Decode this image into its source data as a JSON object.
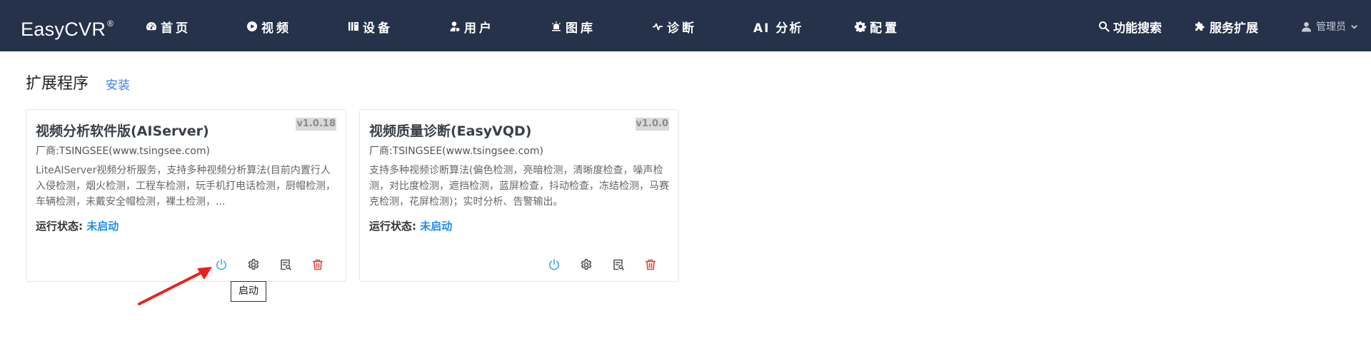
{
  "header": {
    "brand": "EasyCVR",
    "brand_mark": "®",
    "nav": [
      {
        "label": "首页",
        "icon": "dashboard-icon"
      },
      {
        "label": "视频",
        "icon": "play-circle-icon"
      },
      {
        "label": "设备",
        "icon": "device-icon"
      },
      {
        "label": "用户",
        "icon": "user-icon"
      },
      {
        "label": "图库",
        "icon": "gallery-icon"
      },
      {
        "label": "诊断",
        "icon": "pulse-icon"
      },
      {
        "label": "AI 分析",
        "icon": ""
      },
      {
        "label": "配置",
        "icon": "gear-icon"
      }
    ],
    "search_label": "功能搜索",
    "extension_label": "服务扩展",
    "admin_label": "管理员"
  },
  "page": {
    "title": "扩展程序",
    "install_label": "安装"
  },
  "cards": [
    {
      "name": "视频分析软件版(AIServer)",
      "version": "v1.0.18",
      "vendor": "厂商:TSINGSEE(www.tsingsee.com)",
      "description": "LiteAIServer视频分析服务，支持多种视频分析算法(目前内置行人入侵检测，烟火检测，工程车检测，玩手机打电话检测，厨帽检测，车辆检测，未戴安全帽检测，裸土检测，...",
      "status_label": "运行状态: ",
      "status_value": "未启动"
    },
    {
      "name": "视频质量诊断(EasyVQD)",
      "version": "v1.0.0",
      "vendor": "厂商:TSINGSEE(www.tsingsee.com)",
      "description": "支持多种视频诊断算法(偏色检测，亮暗检测，清晰度检查，噪声检测，对比度检测，遮挡检测，蓝屏检查，抖动检查，冻结检测，马赛克检测，花屏检测)；实时分析、告警输出。",
      "status_label": "运行状态: ",
      "status_value": "未启动"
    }
  ],
  "tooltip": "启动",
  "colors": {
    "navbar": "#25324a",
    "link": "#3a82ef",
    "status": "#1e8df0",
    "power": "#40a5e8",
    "delete": "#e5443c",
    "annotation_arrow": "#e8221b"
  }
}
